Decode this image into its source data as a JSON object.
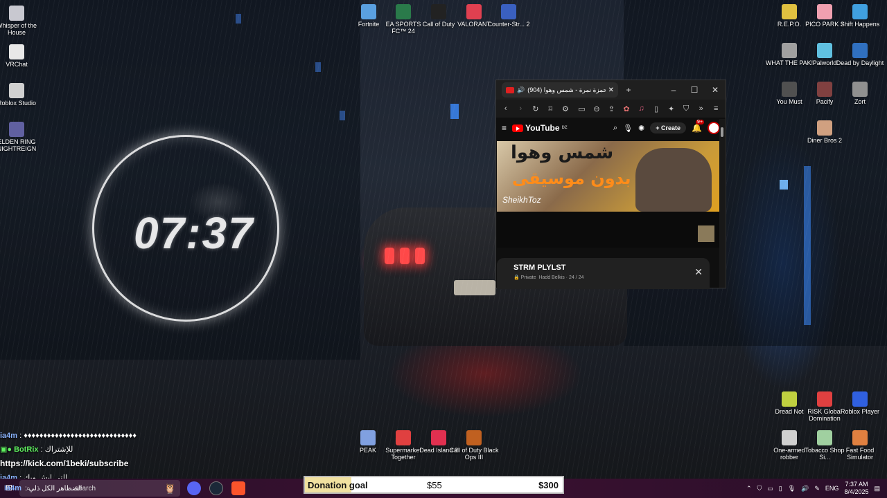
{
  "desktop_icons_left": [
    {
      "label": "Whisper of the House",
      "icon": "whisper-house-icon",
      "color": "#c8c8d0"
    },
    {
      "label": "VRChat",
      "icon": "vrchat-icon",
      "color": "#e8e8e8"
    },
    {
      "label": "Roblox Studio",
      "icon": "roblox-studio-icon",
      "color": "#d0d0d0"
    },
    {
      "label": "ELDEN RING NIGHTREIGN",
      "icon": "elden-ring-icon",
      "color": "#6060a0"
    }
  ],
  "desktop_icons_top": [
    {
      "label": "Fortnite",
      "icon": "fortnite-icon",
      "color": "#5aa0e0"
    },
    {
      "label": "EA SPORTS FC™ 24",
      "icon": "ea-fc-icon",
      "color": "#2a7a4a"
    },
    {
      "label": "Call of Duty",
      "icon": "call-of-duty-icon",
      "color": "#222222"
    },
    {
      "label": "VALORANT",
      "icon": "valorant-icon",
      "color": "#e04050"
    },
    {
      "label": "Counter-Str... 2",
      "icon": "counter-strike-icon",
      "color": "#3a60c0"
    }
  ],
  "desktop_icons_right": [
    {
      "label": "R.E.P.O.",
      "icon": "repo-icon",
      "color": "#e0c040"
    },
    {
      "label": "PICO PARK 2",
      "icon": "pico-park-icon",
      "color": "#f0a0b0"
    },
    {
      "label": "Shift Happens",
      "icon": "shift-happens-icon",
      "color": "#40a0e0"
    },
    {
      "label": "WHAT THE PAK!",
      "icon": "what-the-pak-icon",
      "color": "#a0a0a0"
    },
    {
      "label": "Palworld",
      "icon": "palworld-icon",
      "color": "#60c0e0"
    },
    {
      "label": "Dead by Daylight",
      "icon": "dead-by-daylight-icon",
      "color": "#3070c0"
    },
    {
      "label": "You Must",
      "icon": "you-must-icon",
      "color": "#505050"
    },
    {
      "label": "Pacify",
      "icon": "pacify-icon",
      "color": "#804040"
    },
    {
      "label": "Zort",
      "icon": "zort-icon",
      "color": "#909090"
    },
    {
      "label": "Diner Bros 2",
      "icon": "diner-bros-icon",
      "color": "#d0a080"
    }
  ],
  "desktop_icons_bottom_right": [
    {
      "label": "Dread Not",
      "icon": "dread-not-icon",
      "color": "#c0d040"
    },
    {
      "label": "RISK Global Domination",
      "icon": "risk-icon",
      "color": "#e04040"
    },
    {
      "label": "Roblox Player",
      "icon": "roblox-player-icon",
      "color": "#3060e0"
    },
    {
      "label": "One-armed robber",
      "icon": "one-armed-robber-icon",
      "color": "#d0d0d0"
    },
    {
      "label": "Tobacco Shop Si...",
      "icon": "tobacco-shop-icon",
      "color": "#a0d0a0"
    },
    {
      "label": "Fast Food Simulator",
      "icon": "fast-food-icon",
      "color": "#e08040"
    }
  ],
  "desktop_icons_bottom": [
    {
      "label": "PEAK",
      "icon": "peak-icon",
      "color": "#80a0e0"
    },
    {
      "label": "Supermarket Together",
      "icon": "supermarket-icon",
      "color": "#e04040"
    },
    {
      "label": "Dead Island 2",
      "icon": "dead-island-icon",
      "color": "#e03050"
    },
    {
      "label": "Call of Duty Black Ops III",
      "icon": "black-ops-icon",
      "color": "#c06020"
    }
  ],
  "clock_widget": {
    "time": "07:37"
  },
  "browser": {
    "tab_title": "(904) حمزة نمرة - شمس وهوا",
    "youtube": {
      "logo_text": "YouTube",
      "logo_region": "DZ",
      "create_label": "Create",
      "notification_count": "9+"
    },
    "thumbnail": {
      "line1": "شمس وهوا",
      "line2": "بدون موسيقى",
      "signature": "SheikhToz"
    },
    "playlist": {
      "title": "STRM PLYLST",
      "privacy": "Private",
      "owner": "Hadd Belkis",
      "progress": "24 / 24"
    }
  },
  "chat": [
    {
      "user": "ia4m",
      "text": ": ♦♦♦♦♦♦♦♦♦♦♦♦♦♦♦♦♦♦♦♦♦♦♦♦♦♦♦♦♦"
    },
    {
      "user": "BotRix",
      "text": ": للإشتراك"
    },
    {
      "link": "https://kick.com/1beki/subscribe"
    },
    {
      "user": "ia4m",
      "text": ": التي ايش وبك"
    },
    {
      "user": "ia4m",
      "text": ": الضظاهر الكل ذلي"
    }
  ],
  "taskbar": {
    "search_placeholder": "search",
    "donation": {
      "label": "Donation goal",
      "current": "$55",
      "goal": "$300",
      "progress": 0.18
    },
    "tray": {
      "language": "ENG",
      "time": "7:37 AM",
      "date": "8/4/2025"
    }
  }
}
